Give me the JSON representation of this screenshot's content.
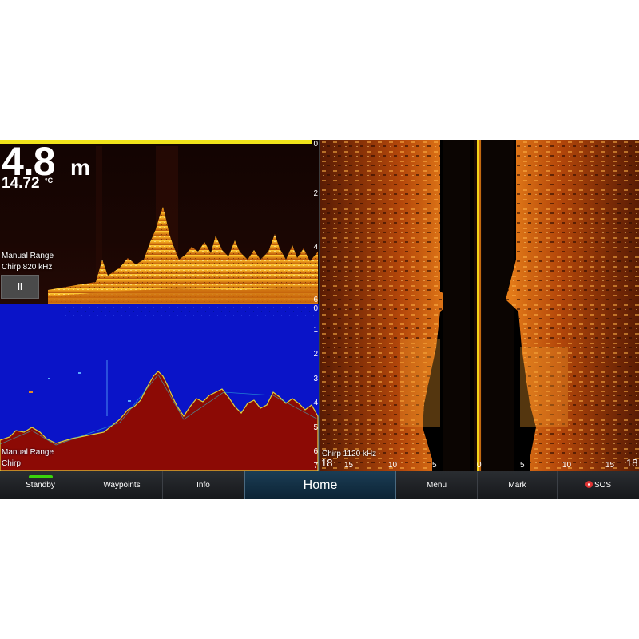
{
  "sonar": {
    "depth": "4.8",
    "depth_unit": "m",
    "temperature": "14.72",
    "temperature_unit": "°C",
    "upper_panel": {
      "range_mode": "Manual Range",
      "frequency": "Chirp 820 kHz",
      "pause_label": "II",
      "scale": [
        "0",
        "2",
        "4",
        "6"
      ]
    },
    "lower_panel": {
      "range_mode": "Manual Range",
      "frequency": "Chirp",
      "scale": [
        "0",
        "1",
        "2",
        "3",
        "4",
        "5",
        "6",
        "7"
      ]
    },
    "side_panel": {
      "frequency": "Chirp 1120 kHz",
      "scale_left": [
        "18",
        "15",
        "10",
        "5",
        "0"
      ],
      "scale_right": [
        "5",
        "10",
        "15",
        "18"
      ]
    }
  },
  "nav": {
    "standby": "Standby",
    "waypoints": "Waypoints",
    "info": "Info",
    "home": "Home",
    "menu": "Menu",
    "mark": "Mark",
    "sos": "SOS"
  },
  "colors": {
    "accent_yellow": "#f0e31a",
    "standby_green": "#39d40b",
    "clearvu_blue": "#0a14c8",
    "bottom_red": "#8c0a05",
    "sos_red": "#e13535"
  }
}
